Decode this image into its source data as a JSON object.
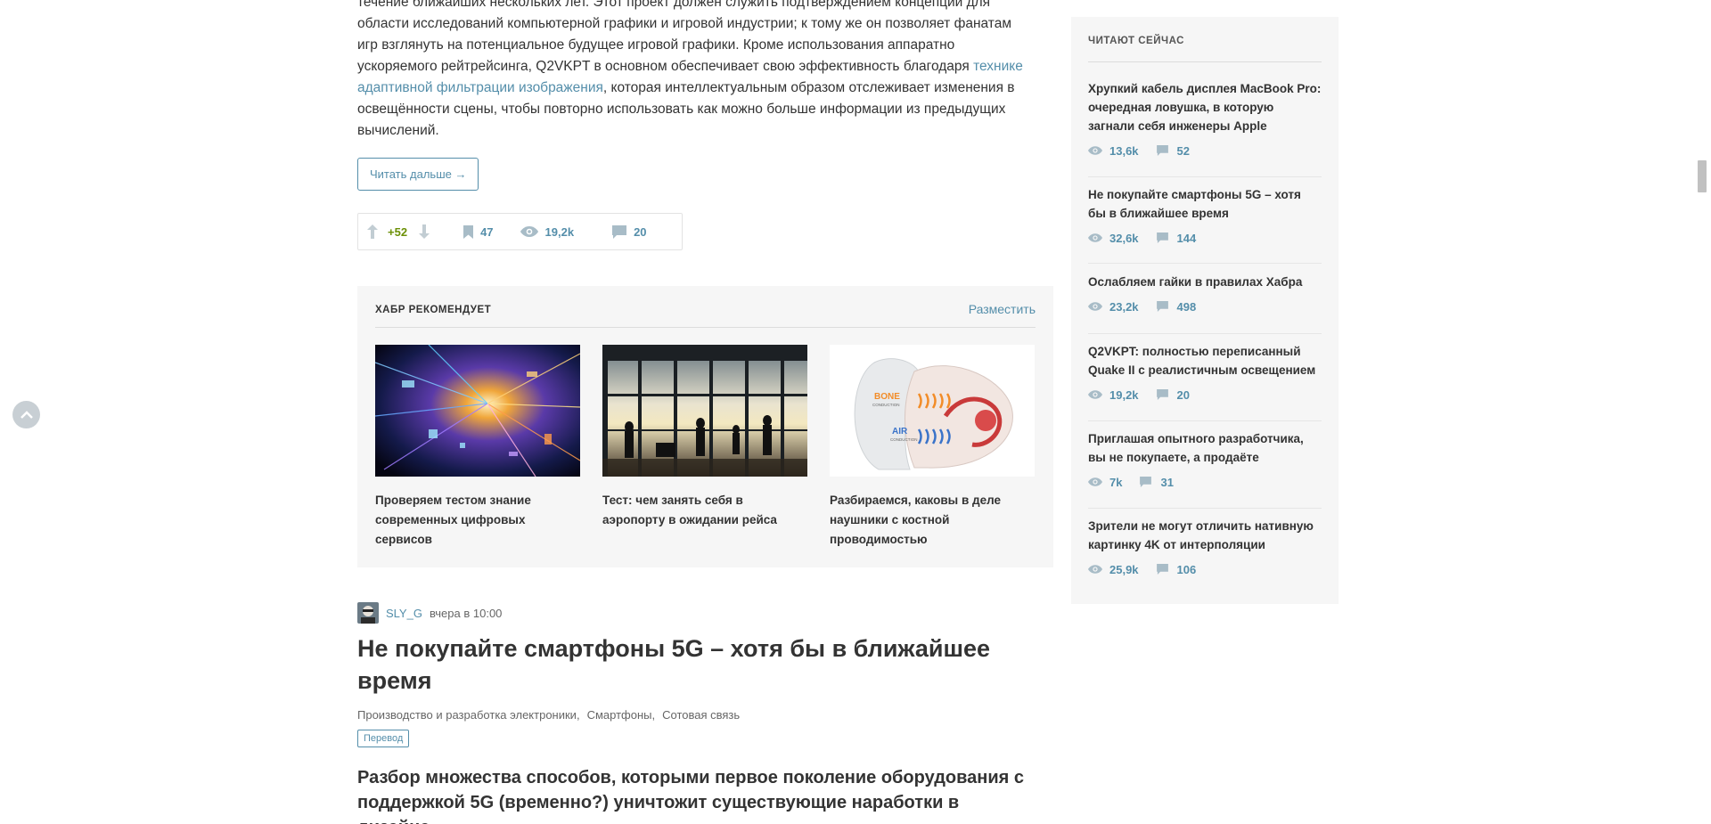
{
  "article": {
    "text_lines": [
      "течение ближайших нескольких лет. Этот проект должен служить подтверждением концепции для",
      "области исследований компьютерной графики и игровой индустрии; к тому же он позволяет фанатам",
      "игр взглянуть на потенциальное будущее игровой графики. Кроме использования аппаратно",
      "ускоряемого рейтрейсинга, Q2VKPT в основном обеспечивает свою эффективность благодаря "
    ],
    "link_part1": "технике",
    "link_part2": "адаптивной фильтрации изображения",
    "text_after_link": ", которая интеллектуальным образом отслеживает изменения в",
    "text_lines_end": [
      "освещённости сцены, чтобы повторно использовать как можно больше информации из предыдущих",
      "вычислений."
    ],
    "read_more": "Читать дальше →",
    "score": "+52",
    "bookmarks": "47",
    "views": "19,2k",
    "comments": "20"
  },
  "recommend": {
    "title": "ХАБР РЕКОМЕНДУЕТ",
    "place": "Разместить",
    "cards": [
      {
        "caption": "Проверяем тестом знание современных цифровых сервисов"
      },
      {
        "caption": "Тест: чем занять себя в аэропорту в ожидании рейса"
      },
      {
        "caption": "Разбираемся, каковы в деле наушники с костной проводимостью",
        "img_text_1": "BONE",
        "img_text_1b": "CONDUCTION",
        "img_text_2": "AIR",
        "img_text_2b": "CONDUCTION"
      }
    ]
  },
  "post": {
    "author": "SLY_G",
    "time": "вчера в 10:00",
    "title": "Не покупайте смартфоны 5G – хотя бы в ближайшее время",
    "hubs": [
      "Производство и разработка электроники",
      "Смартфоны",
      "Сотовая связь"
    ],
    "badge": "Перевод",
    "lead": "Разбор множества способов, которыми первое поколение оборудования с поддержкой 5G (временно?) уничтожит существующие наработки в дизайне"
  },
  "sidebar": {
    "title": "ЧИТАЮТ СЕЙЧАС",
    "items": [
      {
        "title": "Хрупкий кабель дисплея MacBook Pro: очередная ловушка, в которую загнали себя инженеры Apple",
        "views": "13,6k",
        "comments": "52"
      },
      {
        "title": "Не покупайте смартфоны 5G – хотя бы в ближайшее время",
        "views": "32,6k",
        "comments": "144"
      },
      {
        "title": "Ослабляем гайки в правилах Хабра",
        "views": "23,2k",
        "comments": "498"
      },
      {
        "title": "Q2VKPT: полностью переписанный Quake II с реалистичным освещением",
        "views": "19,2k",
        "comments": "20"
      },
      {
        "title": "Приглашая опытного разработчика, вы не покупаете, а продаёте",
        "views": "7k",
        "comments": "31"
      },
      {
        "title": "Зрители не могут отличить нативную картинку 4K от интерполяции",
        "views": "25,9k",
        "comments": "106"
      }
    ]
  },
  "colors": {
    "link": "#548eaa",
    "positive": "#6c9007",
    "panel_bg": "#f6f6f6"
  },
  "icons": [
    "arrow-up-icon",
    "arrow-down-icon",
    "bookmark-icon",
    "eye-icon",
    "comment-icon",
    "chevron-up-icon"
  ]
}
